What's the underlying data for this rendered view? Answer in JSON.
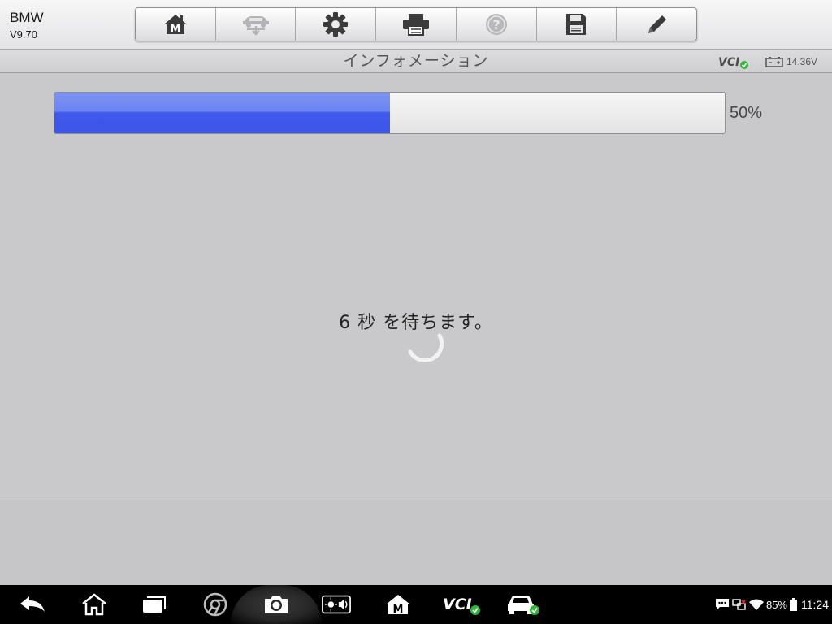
{
  "app": {
    "name": "BMW",
    "version": "V9.70"
  },
  "toolbar": {
    "buttons": [
      {
        "icon": "home-m-icon",
        "enabled": true
      },
      {
        "icon": "car-swap-icon",
        "enabled": false
      },
      {
        "icon": "gear-icon",
        "enabled": true
      },
      {
        "icon": "printer-icon",
        "enabled": true
      },
      {
        "icon": "help-icon",
        "enabled": false
      },
      {
        "icon": "save-icon",
        "enabled": true
      },
      {
        "icon": "pencil-icon",
        "enabled": true
      }
    ]
  },
  "title_bar": {
    "title": "インフォメーション",
    "vci_label": "VCI",
    "battery_voltage": "14.36V"
  },
  "progress": {
    "percent": 50,
    "label": "50%"
  },
  "message": "6 秒 を待ちます。",
  "status_bar": {
    "battery": "85%",
    "time": "11:24"
  },
  "nav_bar": {
    "icons": [
      "back-icon",
      "home-icon",
      "recent-apps-icon",
      "chrome-icon",
      "camera-icon",
      "brightness-volume-icon",
      "maxisys-home-icon",
      "vci-icon",
      "car-icon"
    ],
    "vci_label": "VCI"
  },
  "colors": {
    "progress_fill": "#3f57eb",
    "check_green": "#2fb53c"
  }
}
